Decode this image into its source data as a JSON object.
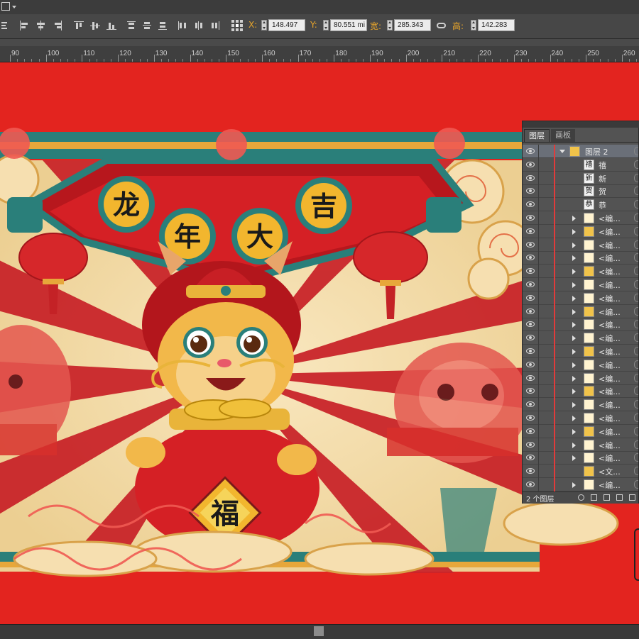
{
  "toolbar": {
    "x_label": "X:",
    "x_value": "148.497",
    "y_label": "Y:",
    "y_value": "80.551 mi",
    "width_label": "宽:",
    "width_value": "285.343",
    "height_label": "高:",
    "height_value": "142.283"
  },
  "ruler": {
    "ticks": [
      "90",
      "100",
      "110",
      "120",
      "130",
      "140",
      "150",
      "160",
      "170",
      "180",
      "190",
      "200",
      "210",
      "220",
      "230",
      "240",
      "250",
      "260"
    ]
  },
  "artwork": {
    "banner_chars": [
      "龙",
      "年",
      "大",
      "吉"
    ],
    "bag_char": "福"
  },
  "layers_panel": {
    "tab_layers": "图层",
    "tab_artboards": "画板",
    "footer": "2 个图层",
    "rows": [
      {
        "name": "图层 2",
        "thumb": "",
        "kind": "group-open",
        "selected": true
      },
      {
        "name": "禧",
        "thumb": "禧",
        "kind": "item"
      },
      {
        "name": "新",
        "thumb": "新",
        "kind": "item"
      },
      {
        "name": "贺",
        "thumb": "贺",
        "kind": "item"
      },
      {
        "name": "恭",
        "thumb": "恭",
        "kind": "item"
      },
      {
        "name": "<编...",
        "thumb": "",
        "kind": "group"
      },
      {
        "name": "<编...",
        "thumb": "",
        "kind": "group"
      },
      {
        "name": "<编...",
        "thumb": "",
        "kind": "group"
      },
      {
        "name": "<编...",
        "thumb": "",
        "kind": "group"
      },
      {
        "name": "<编...",
        "thumb": "",
        "kind": "group"
      },
      {
        "name": "<编...",
        "thumb": "",
        "kind": "group"
      },
      {
        "name": "<编...",
        "thumb": "",
        "kind": "group"
      },
      {
        "name": "<编...",
        "thumb": "",
        "kind": "group"
      },
      {
        "name": "<编...",
        "thumb": "",
        "kind": "group"
      },
      {
        "name": "<编...",
        "thumb": "",
        "kind": "group"
      },
      {
        "name": "<编...",
        "thumb": "",
        "kind": "group"
      },
      {
        "name": "<编...",
        "thumb": "",
        "kind": "group"
      },
      {
        "name": "<编...",
        "thumb": "",
        "kind": "group"
      },
      {
        "name": "<编...",
        "thumb": "",
        "kind": "group"
      },
      {
        "name": "<编...",
        "thumb": "",
        "kind": "group"
      },
      {
        "name": "<编...",
        "thumb": "",
        "kind": "group"
      },
      {
        "name": "<编...",
        "thumb": "",
        "kind": "group"
      },
      {
        "name": "<编...",
        "thumb": "",
        "kind": "group"
      },
      {
        "name": "<编...",
        "thumb": "",
        "kind": "group"
      },
      {
        "name": "<文...",
        "thumb": "",
        "kind": "item"
      },
      {
        "name": "<编...",
        "thumb": "",
        "kind": "group"
      }
    ]
  },
  "colors": {
    "bg_red": "#e3241f",
    "teal": "#2a7f7a",
    "cream": "#f6dfb0",
    "gold": "#e9b43a",
    "panel": "#535353"
  }
}
